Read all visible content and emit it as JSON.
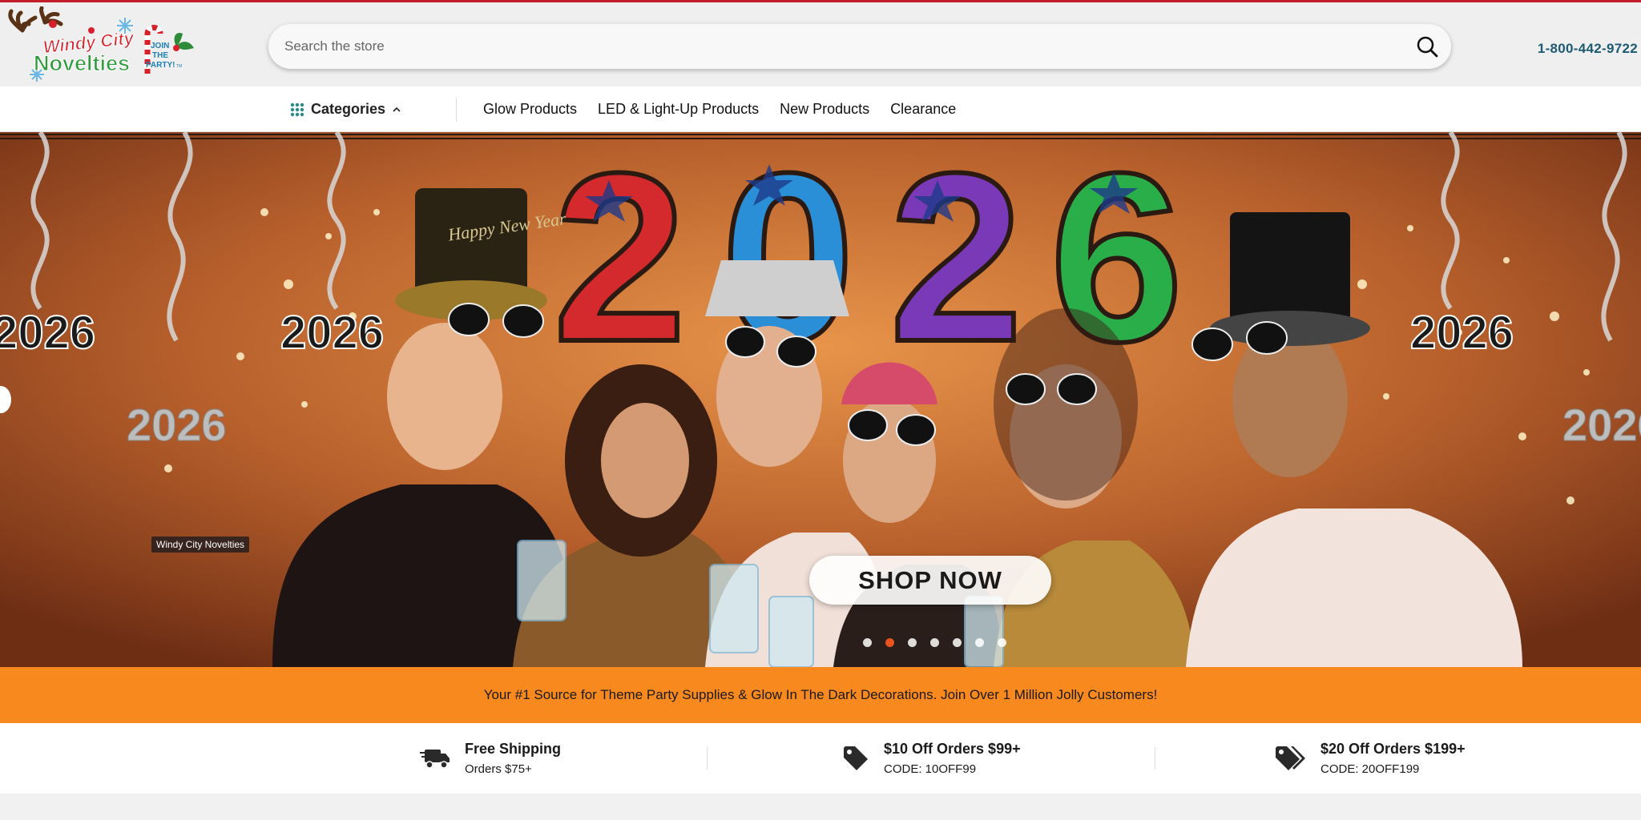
{
  "brand": {
    "logo_line1": "Windy City",
    "logo_line2": "Novelties",
    "logo_tag1": "JOIN",
    "logo_tag2": "THE",
    "logo_tag3": "PARTY!",
    "logo_tm": "TM"
  },
  "search": {
    "placeholder": "Search the store"
  },
  "header": {
    "phone": "1-800-442-9722"
  },
  "nav": {
    "categories_label": "Categories",
    "links": [
      "Glow Products",
      "LED & Light-Up Products",
      "New Products",
      "Clearance"
    ]
  },
  "hero": {
    "year": "2026",
    "shop_now": "SHOP NOW",
    "photo_credit": "Windy City Novelties",
    "hat_text": "Happy New Year",
    "slide_count": 7,
    "active_slide": 2
  },
  "promo": {
    "text": "Your #1 Source for Theme Party Supplies & Glow In The Dark Decorations. Join Over 1 Million Jolly Customers!"
  },
  "features": [
    {
      "icon": "truck-icon",
      "title": "Free Shipping",
      "subtitle": "Orders $75+"
    },
    {
      "icon": "tag-icon",
      "title": "$10 Off Orders $99+",
      "subtitle": "CODE: 10OFF99"
    },
    {
      "icon": "tags-icon",
      "title": "$20 Off Orders $199+",
      "subtitle": "CODE: 20OFF199"
    }
  ],
  "colors": {
    "topline": "#c41e2c",
    "phone": "#1c5a73",
    "promo_bg": "#f8891f",
    "active_dot": "#e8531e"
  }
}
